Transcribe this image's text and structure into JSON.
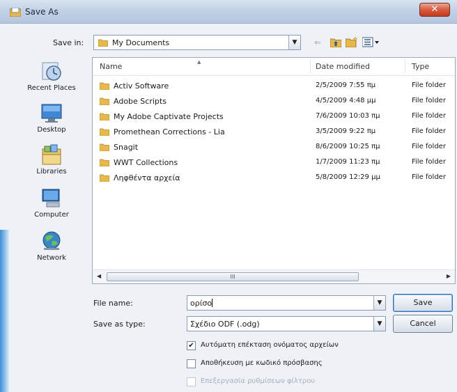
{
  "window": {
    "title": "Save As",
    "close_glyph": "✕"
  },
  "toolbar": {
    "save_in_label": "Save in:",
    "save_in_value": "My Documents",
    "back_glyph": "⇐",
    "up_glyph": "⇧",
    "new_folder_glyph": "▢",
    "views_glyph": "☰▾"
  },
  "places": [
    {
      "label": "Recent Places",
      "icon": "recent-places-icon"
    },
    {
      "label": "Desktop",
      "icon": "desktop-icon"
    },
    {
      "label": "Libraries",
      "icon": "libraries-icon"
    },
    {
      "label": "Computer",
      "icon": "computer-icon"
    },
    {
      "label": "Network",
      "icon": "network-icon"
    }
  ],
  "filelist": {
    "columns": [
      "Name",
      "Date modified",
      "Type"
    ],
    "rows": [
      {
        "name": "Activ Software",
        "date": "2/5/2009 7:55 πμ",
        "type": "File folder"
      },
      {
        "name": "Adobe Scripts",
        "date": "4/5/2009 4:48 μμ",
        "type": "File folder"
      },
      {
        "name": "My Adobe Captivate Projects",
        "date": "7/6/2009 10:03 πμ",
        "type": "File folder"
      },
      {
        "name": "Promethean Corrections - Lia",
        "date": "3/5/2009 9:22 πμ",
        "type": "File folder"
      },
      {
        "name": "Snagit",
        "date": "8/6/2009 10:25 πμ",
        "type": "File folder"
      },
      {
        "name": "WWT Collections",
        "date": "1/7/2009 11:23 πμ",
        "type": "File folder"
      },
      {
        "name": "Ληφθέντα αρχεία",
        "date": "5/8/2009 12:29 μμ",
        "type": "File folder"
      }
    ],
    "scroll_thumb_text": "III"
  },
  "form": {
    "file_name_label": "File name:",
    "file_name_value": "ορίσο",
    "save_as_type_label": "Save as type:",
    "save_as_type_value": "Σχέδιο ODF (.odg)",
    "save_button": "Save",
    "cancel_button": "Cancel",
    "checkboxes": [
      {
        "label": "Αυτόματη επέκταση ονόματος αρχείων",
        "checked": true,
        "enabled": true
      },
      {
        "label": "Αποθήκευση με κωδικό πρόσβασης",
        "checked": false,
        "enabled": true
      },
      {
        "label": "Επεξεργασία ρυθμίσεων φίλτρου",
        "checked": false,
        "enabled": false
      }
    ]
  },
  "colors": {
    "accent": "#3c6fb0",
    "folder": "#e8b84a",
    "close": "#c23a1c"
  }
}
